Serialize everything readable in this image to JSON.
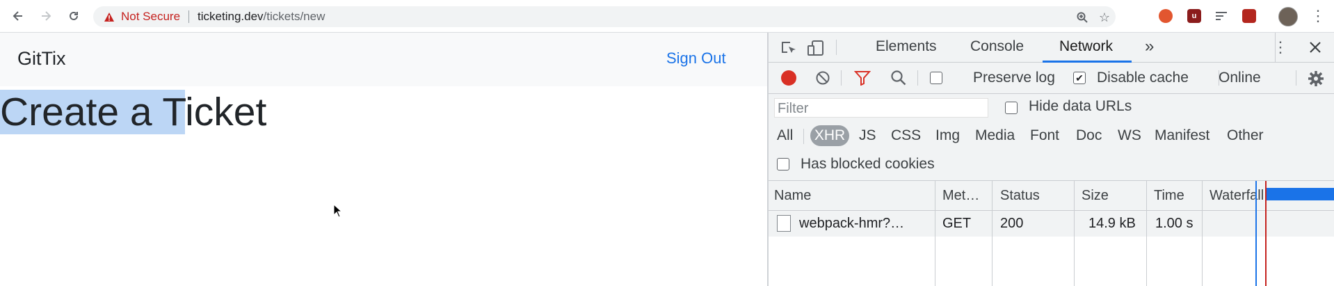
{
  "browser": {
    "security_label": "Not Secure",
    "url_host": "ticketing.dev",
    "url_path": "/tickets/new"
  },
  "page": {
    "brand": "GitTix",
    "sign_out": "Sign Out",
    "heading_selected": "Create a T",
    "heading_rest": "icket"
  },
  "devtools": {
    "tabs": [
      "Elements",
      "Console",
      "Network"
    ],
    "active_tab": "Network",
    "more_tabs": "»",
    "toolbar": {
      "preserve_log": "Preserve log",
      "disable_cache": "Disable cache",
      "throttling": "Online"
    },
    "filter": {
      "placeholder": "Filter",
      "hide_data_urls": "Hide data URLs"
    },
    "types": [
      "All",
      "XHR",
      "JS",
      "CSS",
      "Img",
      "Media",
      "Font",
      "Doc",
      "WS",
      "Manifest",
      "Other"
    ],
    "active_type": "XHR",
    "has_blocked_cookies": "Has blocked cookies",
    "table": {
      "headers": [
        "Name",
        "Met…",
        "Status",
        "Size",
        "Time",
        "Waterfall"
      ],
      "sort_indicator": "▲",
      "rows": [
        {
          "name": "webpack-hmr?…",
          "method": "GET",
          "status": "200",
          "size": "14.9 kB",
          "time": "1.00 s"
        }
      ]
    }
  },
  "colors": {
    "accent": "#1a73e8",
    "record": "#d93025",
    "selection": "#bcd6f5",
    "warning": "#c5221f"
  }
}
